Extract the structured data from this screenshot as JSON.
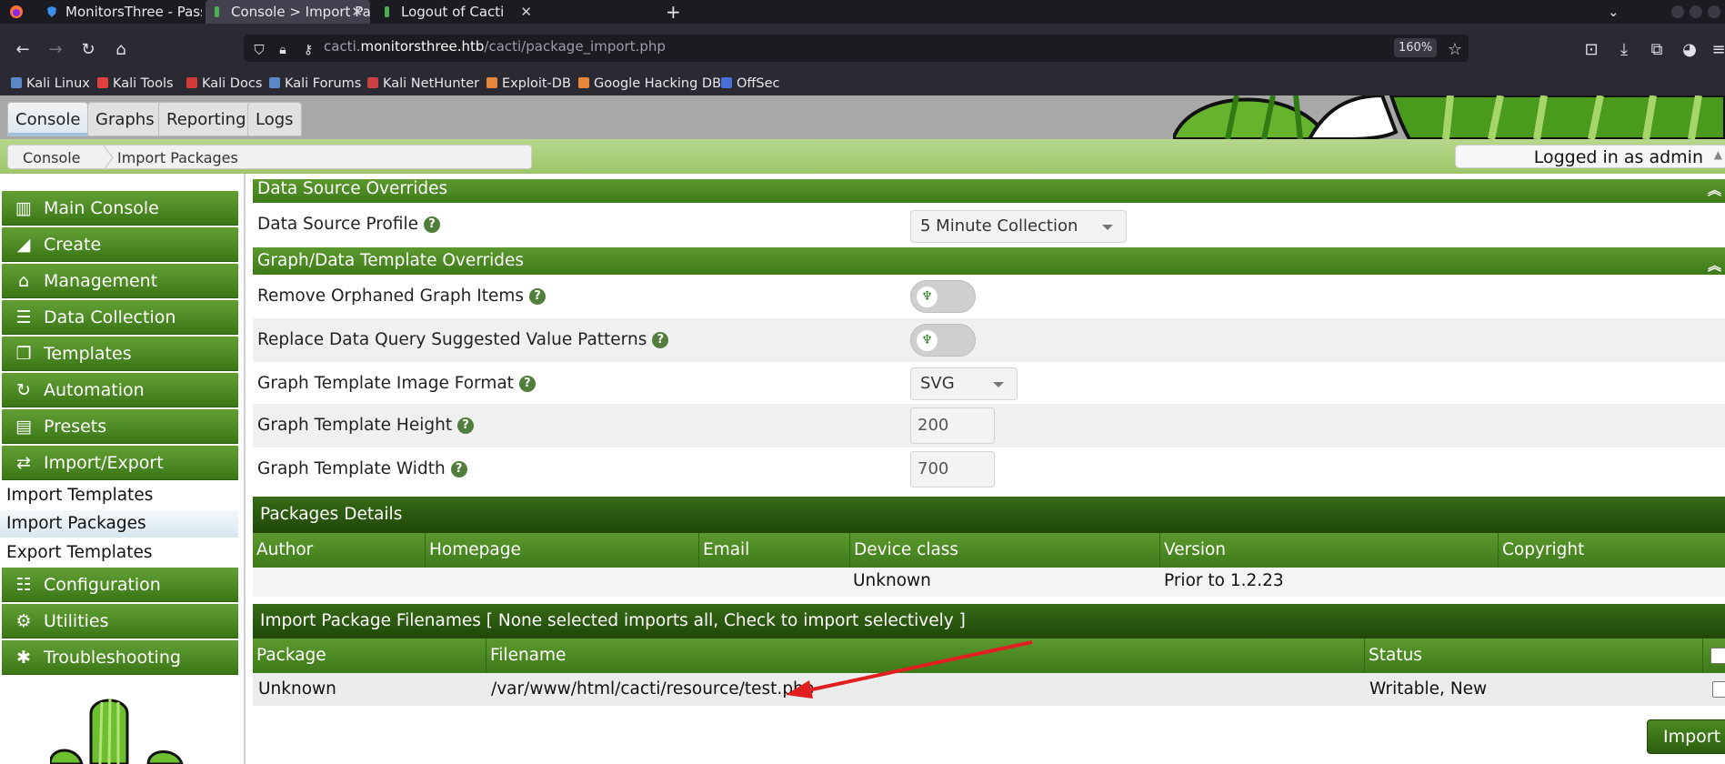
{
  "browser": {
    "tabs": [
      {
        "title": "MonitorsThree - Passwor",
        "active": false
      },
      {
        "title": "Console > Import Packag",
        "active": true
      },
      {
        "title": "Logout of Cacti",
        "active": false
      }
    ],
    "new_tab_label": "+",
    "close_glyph": "✕",
    "address": {
      "prefix": "cacti.",
      "host": "monitorsthree.htb",
      "path": "/cacti/package_import.php"
    },
    "zoom": "160%",
    "bookmarks": [
      {
        "label": "Kali Linux",
        "color": "#5b88c8"
      },
      {
        "label": "Kali Tools",
        "color": "#e04040"
      },
      {
        "label": "Kali Docs",
        "color": "#d23a3a"
      },
      {
        "label": "Kali Forums",
        "color": "#5b88c8"
      },
      {
        "label": "Kali NetHunter",
        "color": "#c84040"
      },
      {
        "label": "Exploit-DB",
        "color": "#e6863a"
      },
      {
        "label": "Google Hacking DB",
        "color": "#e6863a"
      },
      {
        "label": "OffSec",
        "color": "#4a6fd8"
      }
    ]
  },
  "cacti": {
    "top_tabs": [
      "Console",
      "Graphs",
      "Reporting",
      "Logs"
    ],
    "breadcrumb": [
      "Console",
      "Import Packages"
    ],
    "login_status": "Logged in as admin",
    "menu": [
      {
        "label": "Main Console",
        "icon": "map-icon",
        "glyph": "▥"
      },
      {
        "label": "Create",
        "icon": "chart-area-icon",
        "glyph": "◢"
      },
      {
        "label": "Management",
        "icon": "home-icon",
        "glyph": "⌂"
      },
      {
        "label": "Data Collection",
        "icon": "database-icon",
        "glyph": "☰"
      },
      {
        "label": "Templates",
        "icon": "copy-icon",
        "glyph": "❐"
      },
      {
        "label": "Automation",
        "icon": "sync-icon",
        "glyph": "↻"
      },
      {
        "label": "Presets",
        "icon": "archive-icon",
        "glyph": "▤"
      },
      {
        "label": "Import/Export",
        "icon": "exchange-icon",
        "glyph": "⇄"
      }
    ],
    "submenu": [
      {
        "label": "Import Templates",
        "selected": false
      },
      {
        "label": "Import Packages",
        "selected": true
      },
      {
        "label": "Export Templates",
        "selected": false
      }
    ],
    "menu_after": [
      {
        "label": "Configuration",
        "icon": "sliders-icon",
        "glyph": "☷"
      },
      {
        "label": "Utilities",
        "icon": "cogs-icon",
        "glyph": "⚙"
      },
      {
        "label": "Troubleshooting",
        "icon": "bug-icon",
        "glyph": "✱"
      }
    ],
    "data_source_overrides": {
      "title": "Data Source Overrides",
      "profile_label": "Data Source Profile",
      "profile_value": "5 Minute Collection"
    },
    "graph_overrides": {
      "title": "Graph/Data Template Overrides",
      "remove_orphans_label": "Remove Orphaned Graph Items",
      "replace_patterns_label": "Replace Data Query Suggested Value Patterns",
      "image_format_label": "Graph Template Image Format",
      "image_format_value": "SVG",
      "height_label": "Graph Template Height",
      "height_value": "200",
      "width_label": "Graph Template Width",
      "width_value": "700"
    },
    "package_details": {
      "title": "Packages Details",
      "columns": [
        "Author",
        "Homepage",
        "Email",
        "Device class",
        "Version",
        "Copyright"
      ],
      "row": [
        "",
        "",
        "",
        "Unknown",
        "Prior to 1.2.23",
        ""
      ]
    },
    "filenames": {
      "title": "Import Package Filenames [ None selected imports all, Check to import selectively ]",
      "columns": [
        "Package",
        "Filename",
        "Status"
      ],
      "row": {
        "package": "Unknown",
        "filename": "/var/www/html/cacti/resource/test.php",
        "status": "Writable, New"
      }
    },
    "import_button": "Import",
    "colors": {
      "green_header": "#4a8a24",
      "dark_green": "#2a5a0f",
      "annotation_arrow": "#e02020"
    }
  }
}
